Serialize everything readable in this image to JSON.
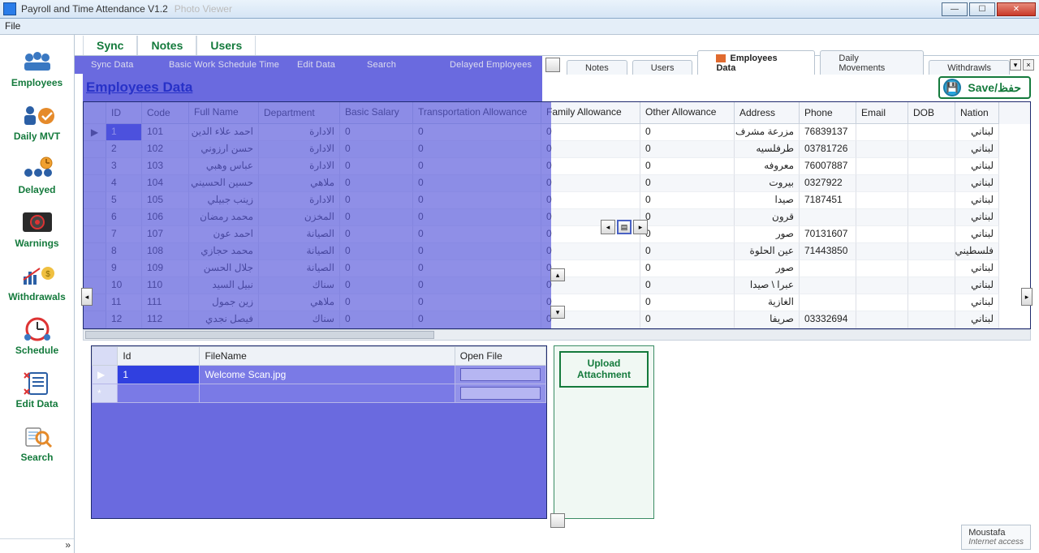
{
  "window": {
    "title": "Payroll and Time Attendance V1.2",
    "shadow_title": "Photo Viewer",
    "menu_file": "File"
  },
  "sidebar": {
    "items": [
      {
        "label": "Employees"
      },
      {
        "label": "Daily MVT"
      },
      {
        "label": "Delayed"
      },
      {
        "label": "Warnings"
      },
      {
        "label": "Withdrawals"
      },
      {
        "label": "Schedule"
      },
      {
        "label": "Edit Data"
      },
      {
        "label": "Search"
      }
    ],
    "expand_glyph": "»"
  },
  "green_tabs": [
    "Sync",
    "Notes",
    "Users"
  ],
  "purple_tabs": [
    "Sync Data",
    "Basic Work Schedule Time",
    "Edit Data",
    "Search",
    "Delayed Employees"
  ],
  "white_tabs": [
    {
      "label": "Notes",
      "active": false
    },
    {
      "label": "Users",
      "active": false
    },
    {
      "label": "Employees Data",
      "active": true,
      "has_icon": true
    },
    {
      "label": "Daily Movements",
      "active": false
    },
    {
      "label": "Withdrawls",
      "active": false
    }
  ],
  "tab_end": {
    "dropdown": "▾",
    "close": "×"
  },
  "page": {
    "heading": "Employees Data",
    "save_label": "Save/حفظ"
  },
  "grid": {
    "columns": [
      "ID",
      "Code",
      "Full Name",
      "Department",
      "Basic Salary",
      "Transportation Allowance",
      "Family Allowance",
      "Other Allowance",
      "Address",
      "Phone",
      "Email",
      "DOB",
      "Nation"
    ],
    "rows": [
      {
        "marker": "▶",
        "id": "1",
        "code": "101",
        "name": "احمد علاء الدين",
        "dept": "الادارة",
        "basic": "0",
        "trans": "0",
        "fam": "0",
        "other": "0",
        "addr": "مزرعة مشرف",
        "phone": "76839137",
        "email": "",
        "dob": "",
        "nat": "لبناني"
      },
      {
        "marker": "",
        "id": "2",
        "code": "102",
        "name": "حسن ارزوني",
        "dept": "الادارة",
        "basic": "0",
        "trans": "0",
        "fam": "0",
        "other": "0",
        "addr": "طرفلسيه",
        "phone": "03781726",
        "email": "",
        "dob": "",
        "nat": "لبناني"
      },
      {
        "marker": "",
        "id": "3",
        "code": "103",
        "name": "عباس وهبي",
        "dept": "الادارة",
        "basic": "0",
        "trans": "0",
        "fam": "0",
        "other": "0",
        "addr": "معروفه",
        "phone": "76007887",
        "email": "",
        "dob": "",
        "nat": "لبناني"
      },
      {
        "marker": "",
        "id": "4",
        "code": "104",
        "name": "حسين الحسيني",
        "dept": "ملاهي",
        "basic": "0",
        "trans": "0",
        "fam": "0",
        "other": "0",
        "addr": "بيروت",
        "phone": "0327922",
        "email": "",
        "dob": "",
        "nat": "لبناني"
      },
      {
        "marker": "",
        "id": "5",
        "code": "105",
        "name": "زينب جبيلي",
        "dept": "الادارة",
        "basic": "0",
        "trans": "0",
        "fam": "0",
        "other": "0",
        "addr": "صيدا",
        "phone": "7187451",
        "email": "",
        "dob": "",
        "nat": "لبناني"
      },
      {
        "marker": "",
        "id": "6",
        "code": "106",
        "name": "محمد رمضان",
        "dept": "المخزن",
        "basic": "0",
        "trans": "0",
        "fam": "0",
        "other": "0",
        "addr": "قرون",
        "phone": "",
        "email": "",
        "dob": "",
        "nat": "لبناني"
      },
      {
        "marker": "",
        "id": "7",
        "code": "107",
        "name": "احمد عون",
        "dept": "الصيانة",
        "basic": "0",
        "trans": "0",
        "fam": "0",
        "other": "0",
        "addr": "صور",
        "phone": "70131607",
        "email": "",
        "dob": "",
        "nat": "لبناني"
      },
      {
        "marker": "",
        "id": "8",
        "code": "108",
        "name": "محمد حجازي",
        "dept": "الصيانة",
        "basic": "0",
        "trans": "0",
        "fam": "0",
        "other": "0",
        "addr": "عين الحلوة",
        "phone": "71443850",
        "email": "",
        "dob": "",
        "nat": "فلسطيني"
      },
      {
        "marker": "",
        "id": "9",
        "code": "109",
        "name": "جلال الحسن",
        "dept": "الصيانة",
        "basic": "0",
        "trans": "0",
        "fam": "0",
        "other": "0",
        "addr": "صور",
        "phone": "",
        "email": "",
        "dob": "",
        "nat": "لبناني"
      },
      {
        "marker": "",
        "id": "10",
        "code": "110",
        "name": "نبيل السيد",
        "dept": "سناك",
        "basic": "0",
        "trans": "0",
        "fam": "0",
        "other": "0",
        "addr": "عبرا \\ صيدا",
        "phone": "",
        "email": "",
        "dob": "",
        "nat": "لبناني"
      },
      {
        "marker": "",
        "id": "11",
        "code": "111",
        "name": "زين جمول",
        "dept": "ملاهي",
        "basic": "0",
        "trans": "0",
        "fam": "0",
        "other": "0",
        "addr": "الغازية",
        "phone": "",
        "email": "",
        "dob": "",
        "nat": "لبناني"
      },
      {
        "marker": "",
        "id": "12",
        "code": "112",
        "name": "فيصل نجدي",
        "dept": "سناك",
        "basic": "0",
        "trans": "0",
        "fam": "0",
        "other": "0",
        "addr": "صريفا",
        "phone": "03332694",
        "email": "",
        "dob": "",
        "nat": "لبناني"
      }
    ]
  },
  "attachments": {
    "columns": [
      "Id",
      "FileName",
      "Open File"
    ],
    "rows": [
      {
        "marker": "▶",
        "id": "1",
        "filename": "Welcome Scan.jpg"
      }
    ],
    "new_row_marker": "*",
    "upload_label": "Upload Attachment"
  },
  "splitter": {
    "left": "◂",
    "right": "▸",
    "up": "▴",
    "down": "▾"
  },
  "status": {
    "user": "Moustafa",
    "net": "Internet access"
  }
}
